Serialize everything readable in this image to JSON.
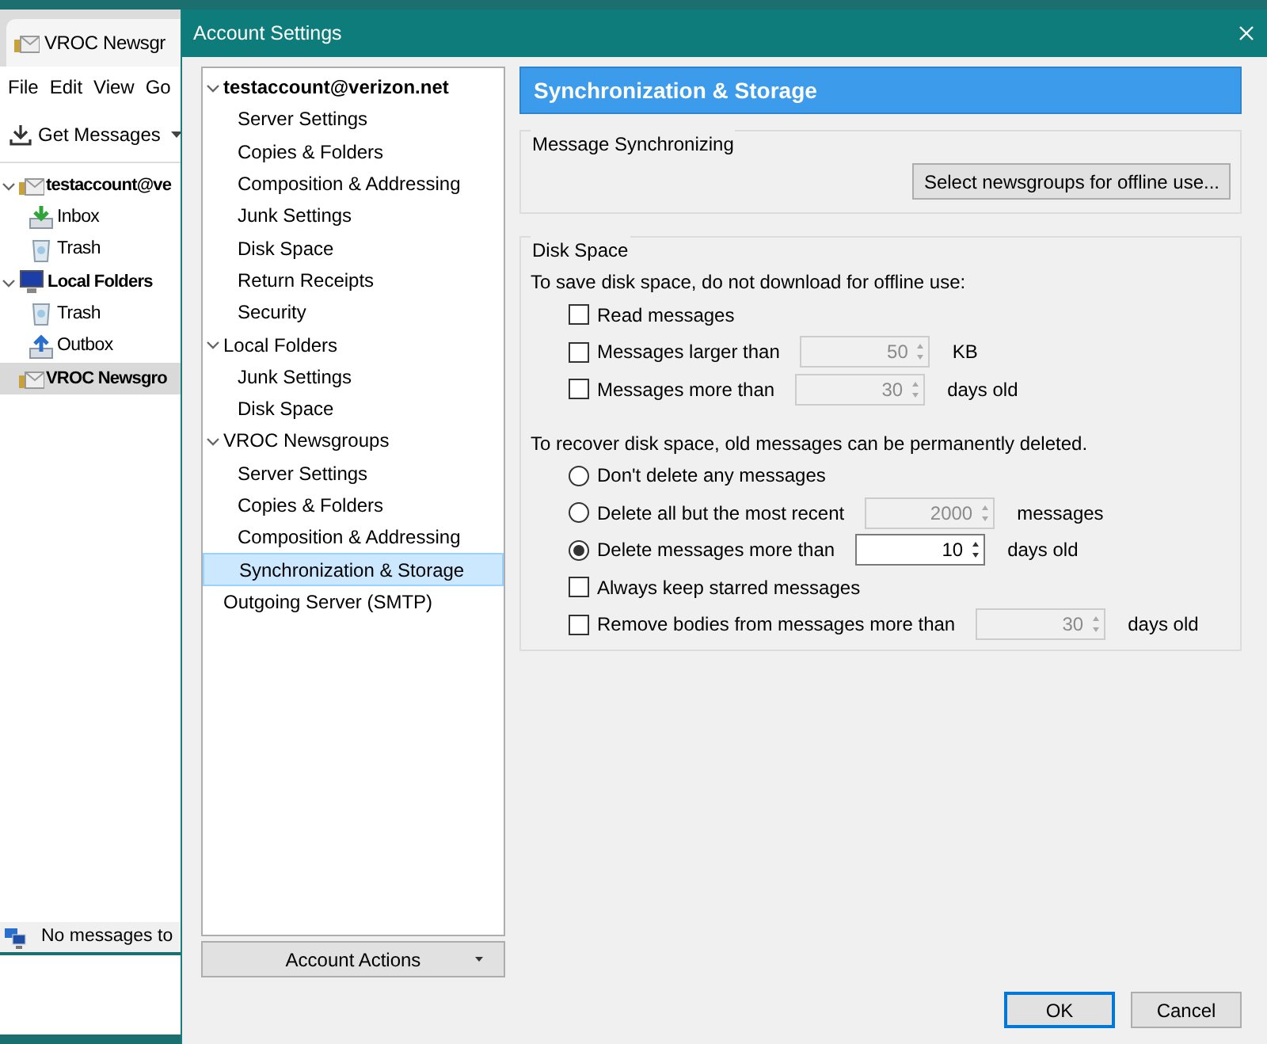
{
  "app": {
    "tab_title": "VROC Newsgr",
    "menu": [
      "File",
      "Edit",
      "View",
      "Go"
    ],
    "get_messages": "Get Messages",
    "folders": [
      {
        "label": "testaccount@ve",
        "kind": "account",
        "bold": true,
        "expanded": true,
        "selected": false,
        "children": [
          {
            "label": "Inbox",
            "kind": "inbox",
            "bold": false,
            "selected": false
          },
          {
            "label": "Trash",
            "kind": "trash",
            "bold": false,
            "selected": false
          }
        ]
      },
      {
        "label": "Local Folders",
        "kind": "computer",
        "bold": true,
        "expanded": true,
        "selected": false,
        "children": [
          {
            "label": "Trash",
            "kind": "trash",
            "bold": false,
            "selected": false
          },
          {
            "label": "Outbox",
            "kind": "outbox",
            "bold": false,
            "selected": false
          }
        ]
      },
      {
        "label": "VROC Newsgro",
        "kind": "account",
        "bold": true,
        "selected": true
      }
    ],
    "status": "No messages to"
  },
  "dialog": {
    "title": "Account Settings",
    "tree": [
      {
        "label": "testaccount@verizon.net",
        "bold": true,
        "expanded": true,
        "selected": false,
        "children": [
          {
            "label": "Server Settings",
            "selected": false
          },
          {
            "label": "Copies & Folders",
            "selected": false
          },
          {
            "label": "Composition & Addressing",
            "selected": false
          },
          {
            "label": "Junk Settings",
            "selected": false
          },
          {
            "label": "Disk Space",
            "selected": false
          },
          {
            "label": "Return Receipts",
            "selected": false
          },
          {
            "label": "Security",
            "selected": false
          }
        ]
      },
      {
        "label": "Local Folders",
        "bold": false,
        "expanded": true,
        "selected": false,
        "children": [
          {
            "label": "Junk Settings",
            "selected": false
          },
          {
            "label": "Disk Space",
            "selected": false
          }
        ]
      },
      {
        "label": "VROC Newsgroups",
        "bold": false,
        "expanded": true,
        "selected": false,
        "children": [
          {
            "label": "Server Settings",
            "selected": false
          },
          {
            "label": "Copies & Folders",
            "selected": false
          },
          {
            "label": "Composition & Addressing",
            "selected": false
          },
          {
            "label": "Synchronization & Storage",
            "selected": true
          }
        ]
      },
      {
        "label": "Outgoing Server (SMTP)",
        "bold": false,
        "selected": false
      }
    ],
    "account_actions": "Account Actions",
    "heading": "Synchronization & Storage",
    "sync": {
      "legend": "Message Synchronizing",
      "button": "Select newsgroups for offline use..."
    },
    "disk": {
      "legend": "Disk Space",
      "intro": "To save disk space, do not download for offline use:",
      "offline": [
        {
          "kind": "checkbox",
          "label": "Read messages",
          "checked": false
        },
        {
          "kind": "checkbox",
          "label": "Messages larger than",
          "checked": false,
          "value": "50",
          "unit": "KB",
          "disabled": true
        },
        {
          "kind": "checkbox",
          "label": "Messages more than",
          "checked": false,
          "value": "30",
          "unit": "days old",
          "disabled": true
        }
      ],
      "recover": "To recover disk space, old messages can be permanently deleted.",
      "retention": [
        {
          "kind": "radio",
          "label": "Don't delete any messages",
          "selected": false
        },
        {
          "kind": "radio",
          "label": "Delete all but the most recent",
          "selected": false,
          "value": "2000",
          "unit": "messages",
          "disabled": true
        },
        {
          "kind": "radio",
          "label": "Delete messages more than",
          "selected": true,
          "value": "10",
          "unit": "days old",
          "disabled": false
        },
        {
          "kind": "checkbox",
          "label": "Always keep starred messages",
          "checked": false
        },
        {
          "kind": "checkbox",
          "label": "Remove bodies from messages more than",
          "checked": false,
          "value": "30",
          "unit": "days old",
          "disabled": true
        }
      ]
    },
    "buttons": [
      {
        "label": "OK",
        "default": true
      },
      {
        "label": "Cancel",
        "default": false
      }
    ]
  }
}
